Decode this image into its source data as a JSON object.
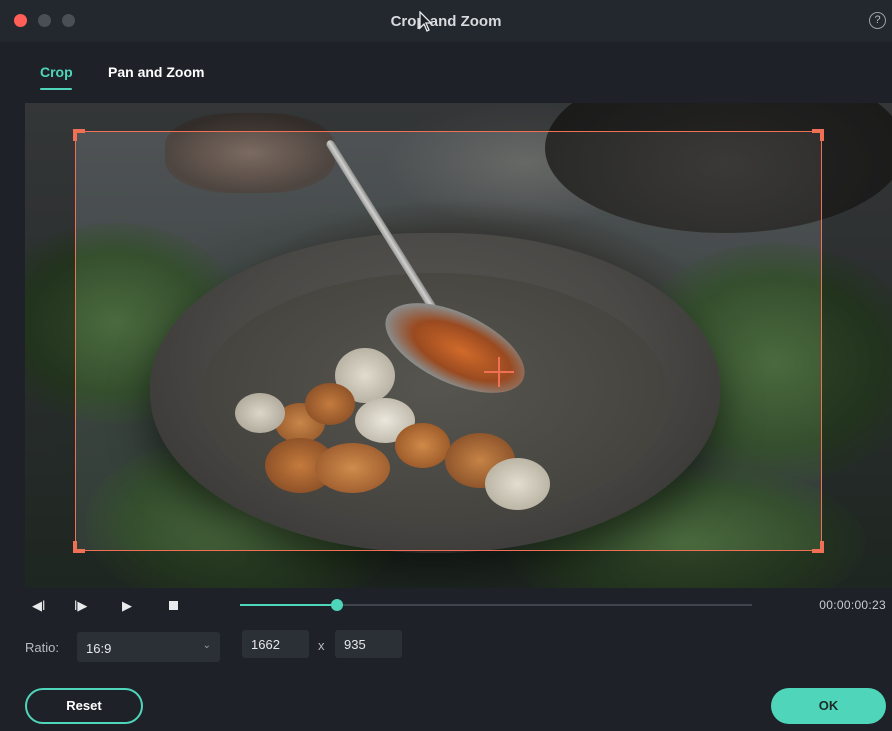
{
  "window": {
    "title": "Crop and Zoom",
    "help_glyph": "?",
    "accent_color": "#4fd6ba",
    "crop_color": "#f07055"
  },
  "tabs": [
    {
      "label": "Crop",
      "active": true
    },
    {
      "label": "Pan and Zoom",
      "active": false
    }
  ],
  "playback": {
    "prev_glyph": "◀ǀ",
    "next_glyph": "ǀ▶",
    "play_glyph": "▶",
    "progress": 0.19,
    "timecode": "00:00:00:23"
  },
  "settings": {
    "ratio_label": "Ratio:",
    "ratio_value": "16:9",
    "width_value": "1662",
    "times": "x",
    "height_value": "935"
  },
  "footer": {
    "reset_label": "Reset",
    "ok_label": "OK"
  }
}
